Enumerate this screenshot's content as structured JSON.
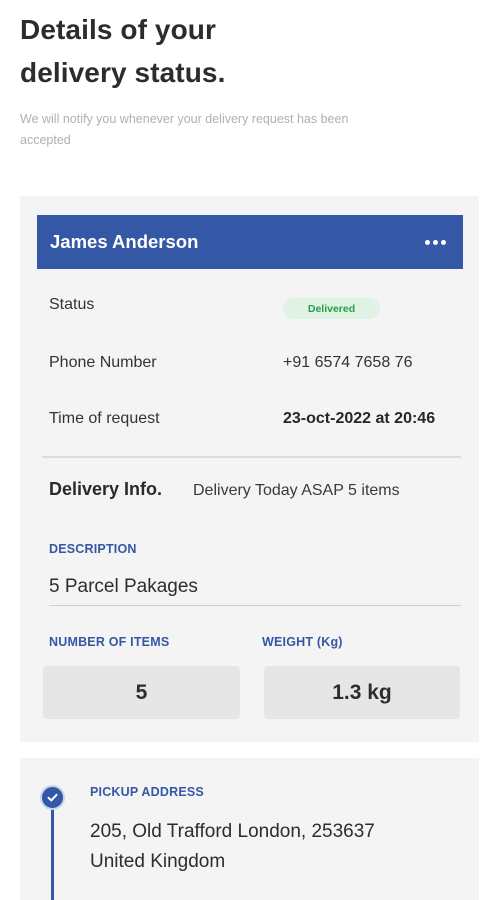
{
  "header": {
    "title_line1": "Details of your",
    "title_line2": "delivery status.",
    "subtitle": "We will notify you whenever your delivery request has been accepted"
  },
  "card": {
    "customer_name": "James Anderson",
    "more_icon": "more-horizontal-icon",
    "status_label": "Status",
    "status_value": "Delivered",
    "phone_label": "Phone Number",
    "phone_value": "+91 6574 7658 76",
    "time_label": "Time of request",
    "time_value": "23-oct-2022 at 20:46",
    "delivery_info_heading": "Delivery Info.",
    "delivery_info_text": "Delivery Today ASAP 5 items",
    "description_label": "DESCRIPTION",
    "description_value": "5 Parcel Pakages",
    "items_label": "NUMBER OF ITEMS",
    "items_value": "5",
    "weight_label": "WEIGHT (Kg)",
    "weight_value": "1.3 kg"
  },
  "pickup": {
    "icon": "check-circle-icon",
    "label": "PICKUP ADDRESS",
    "address_line1": "205, Old Trafford London, 253637",
    "address_line2": "United Kingdom"
  },
  "colors": {
    "accent": "#3457a6",
    "status_green": "#23a046",
    "status_green_bg": "#dff2e3",
    "card_bg": "#f4f4f4"
  }
}
